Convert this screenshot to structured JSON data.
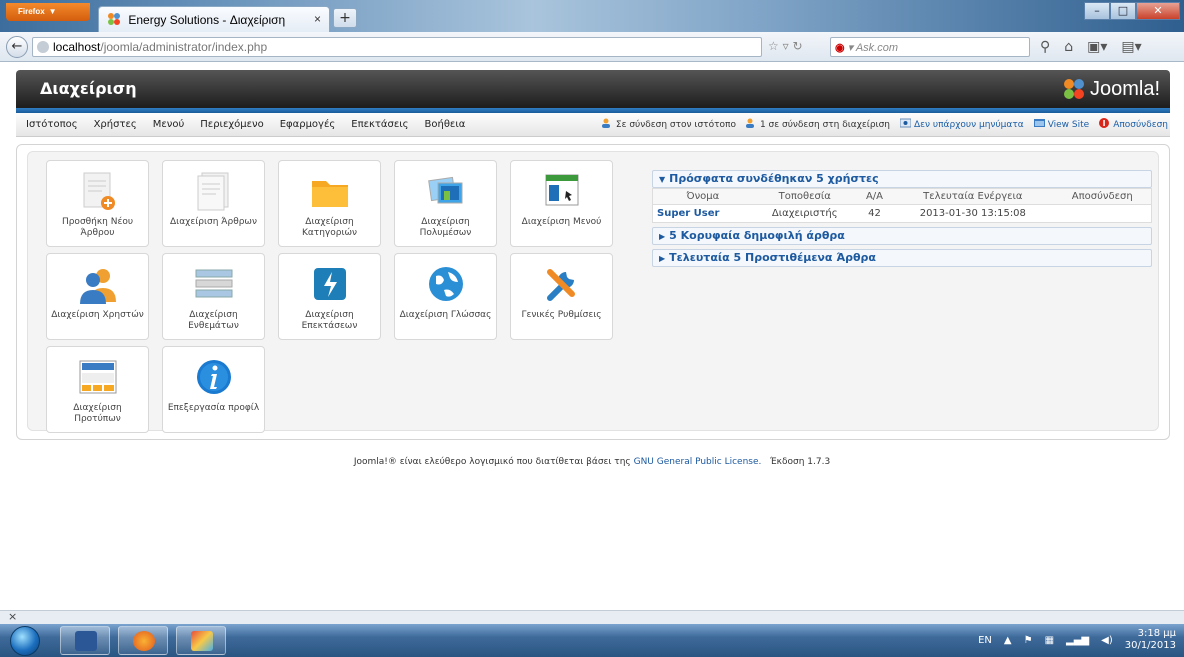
{
  "browser": {
    "menu_button": "Firefox",
    "tab_title": "Energy Solutions - Διαχείριση",
    "url_host": "localhost",
    "url_path": "/joomla/administrator/index.php",
    "search_placeholder": "Ask.com",
    "search_brand": "◉"
  },
  "header": {
    "title": "Διαχείριση",
    "logo_text": "Joomla!"
  },
  "menu": {
    "items": [
      "Ιστότοπος",
      "Χρήστες",
      "Μενού",
      "Περιεχόμενο",
      "Εφαρμογές",
      "Επεκτάσεις",
      "Βοήθεια"
    ]
  },
  "status": {
    "site_online": "Σε σύνδεση στον ιστότοπο",
    "admin_online": "1 σε σύνδεση στη διαχείριση",
    "messages": "Δεν υπάρχουν μηνύματα",
    "view_site": "View Site",
    "logout": "Αποσύνδεση"
  },
  "icons": [
    {
      "label": "Προσθήκη Νέου Άρθρου",
      "icon": "add-article-icon"
    },
    {
      "label": "Διαχείριση Άρθρων",
      "icon": "article-manager-icon"
    },
    {
      "label": "Διαχείριση Κατηγοριών",
      "icon": "category-manager-icon"
    },
    {
      "label": "Διαχείριση Πολυμέσων",
      "icon": "media-manager-icon"
    },
    {
      "label": "Διαχείριση Μενού",
      "icon": "menu-manager-icon"
    },
    {
      "label": "Διαχείριση Χρηστών",
      "icon": "user-manager-icon"
    },
    {
      "label": "Διαχείριση Ενθεμάτων",
      "icon": "module-manager-icon"
    },
    {
      "label": "Διαχείριση Επεκτάσεων",
      "icon": "extension-manager-icon"
    },
    {
      "label": "Διαχείριση Γλώσσας",
      "icon": "language-manager-icon"
    },
    {
      "label": "Γενικές Ρυθμίσεις",
      "icon": "global-config-icon"
    },
    {
      "label": "Διαχείριση Προτύπων",
      "icon": "template-manager-icon"
    },
    {
      "label": "Επεξεργασία προφίλ",
      "icon": "edit-profile-icon"
    }
  ],
  "modules": {
    "logged_in": {
      "title": "Πρόσφατα συνδέθηκαν 5 χρήστες",
      "columns": [
        "Όνομα",
        "Τοποθεσία",
        "Α/Α",
        "Τελευταία Ενέργεια",
        "Αποσύνδεση"
      ],
      "rows": [
        [
          "Super User",
          "Διαχειριστής",
          "42",
          "2013-01-30 13:15:08",
          ""
        ]
      ]
    },
    "popular": {
      "title": "5 Κορυφαία δημοφιλή άρθρα"
    },
    "latest": {
      "title": "Τελευταία 5 Προστιθέμενα Άρθρα"
    }
  },
  "footer": {
    "text_before": "Joomla!® είναι ελεύθερο λογισμικό που διατίθεται βάσει της",
    "license_link": "GNU General Public License.",
    "version": "Έκδοση 1.7.3"
  },
  "ff_status": "×",
  "taskbar": {
    "lang": "EN",
    "time": "3:18 μμ",
    "date": "30/1/2013"
  }
}
